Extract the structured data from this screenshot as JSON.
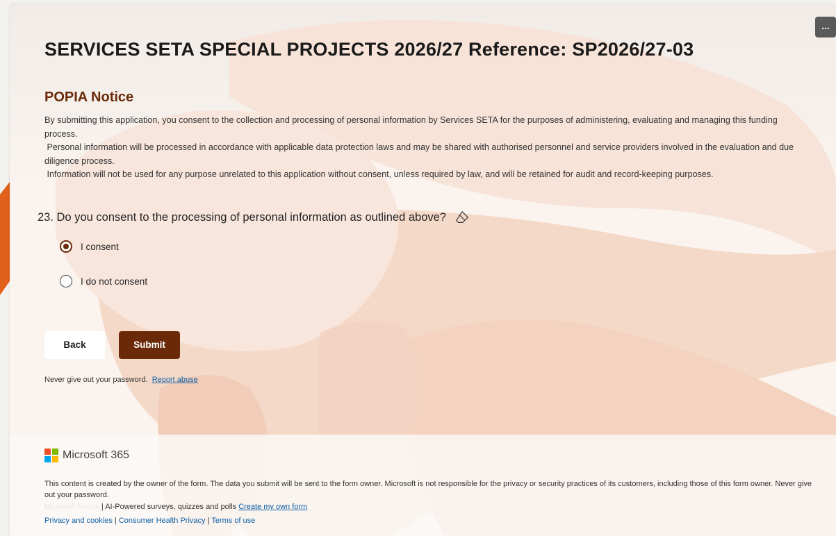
{
  "header": {
    "more_label": "...",
    "title": "SERVICES SETA SPECIAL PROJECTS 2026/27 Reference: SP2026/27-03"
  },
  "notice": {
    "heading": "POPIA Notice",
    "paragraphs": [
      "By submitting this application, you consent to the collection and processing of personal information by Services SETA for the purposes of administering, evaluating and managing this funding process.",
      " Personal information will be processed in accordance with applicable data protection laws and may be shared with authorised personnel and service providers involved in the evaluation and due diligence process.",
      " Information will not be used for any purpose unrelated to this application without consent, unless required by law, and will be retained for audit and record-keeping purposes."
    ]
  },
  "question": {
    "number": "23.",
    "text": "Do you consent to the processing of personal information as outlined above?",
    "icon": "eraser-icon",
    "options": [
      {
        "label": "I consent",
        "selected": true
      },
      {
        "label": "I do not consent",
        "selected": false
      }
    ]
  },
  "actions": {
    "back_label": "Back",
    "submit_label": "Submit"
  },
  "security": {
    "note": "Never give out your password.",
    "report_link": "Report abuse"
  },
  "footer": {
    "brand": "Microsoft 365",
    "disclaimer": "This content is created by the owner of the form. The data you submit will be sent to the form owner. Microsoft is not responsible for the privacy or security practices of its customers, including those of this form owner. Never give out your password.",
    "ghost_brand": "Microsoft Forms",
    "tagline": " | AI-Powered surveys, quizzes and polls ",
    "create_link": "Create my own form",
    "links": [
      "Privacy and cookies",
      "Consumer Health Privacy",
      "Terms of use"
    ],
    "separator": " | "
  },
  "colors": {
    "accent": "#6a2a08",
    "link": "#0f5fa8",
    "background_art": "#f6d7c6",
    "orange_ribbon": "#e2611a"
  }
}
